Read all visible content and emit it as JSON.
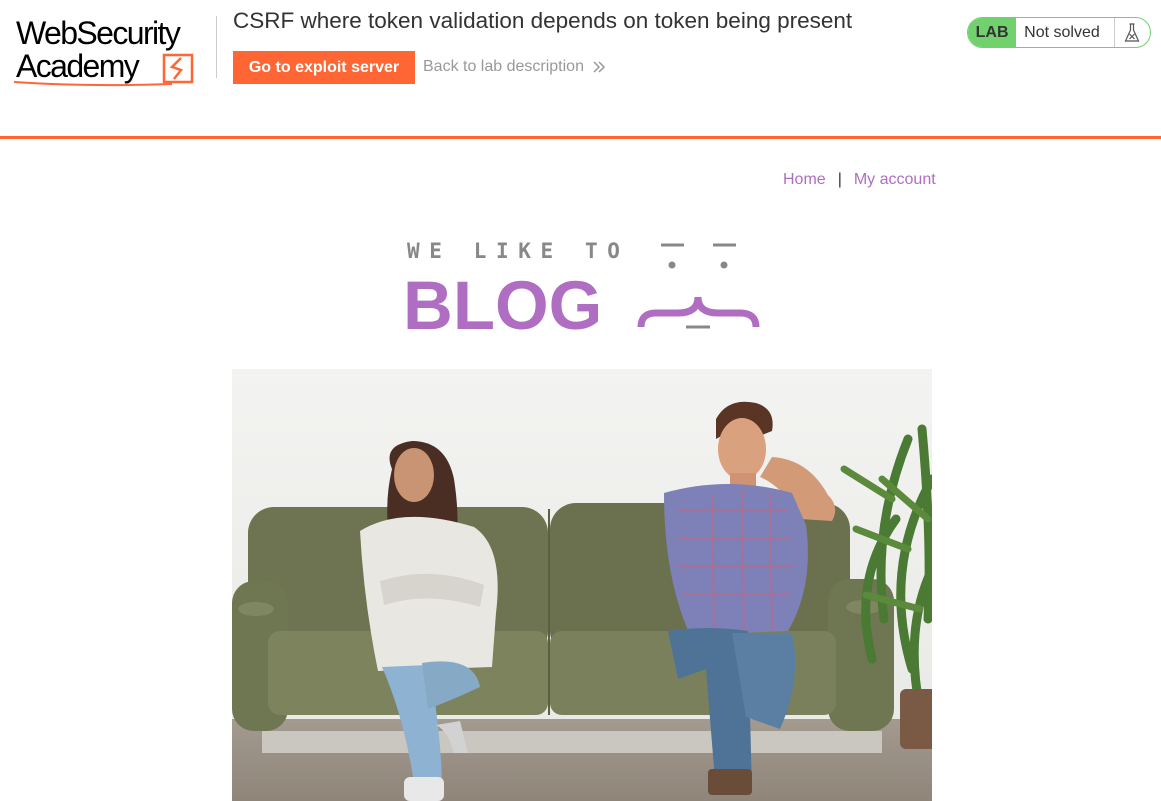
{
  "header": {
    "logo": {
      "line1": "WebSecurity",
      "line2": "Academy"
    },
    "lab_title": "CSRF where token validation depends on token being present",
    "exploit_button": "Go to exploit server",
    "back_link": "Back to lab description",
    "status": {
      "lab_label": "LAB",
      "state": "Not solved",
      "icon": "flask-icon"
    }
  },
  "nav": {
    "items": [
      {
        "label": "Home"
      },
      {
        "label": "My account"
      }
    ],
    "separator": "|"
  },
  "banner": {
    "top_text": "WE LIKE TO",
    "main_text": "BLOG"
  },
  "colors": {
    "accent": "#ff6633",
    "link": "#b06ec2",
    "solved_green": "#70d16d",
    "banner_gray": "#888888"
  }
}
